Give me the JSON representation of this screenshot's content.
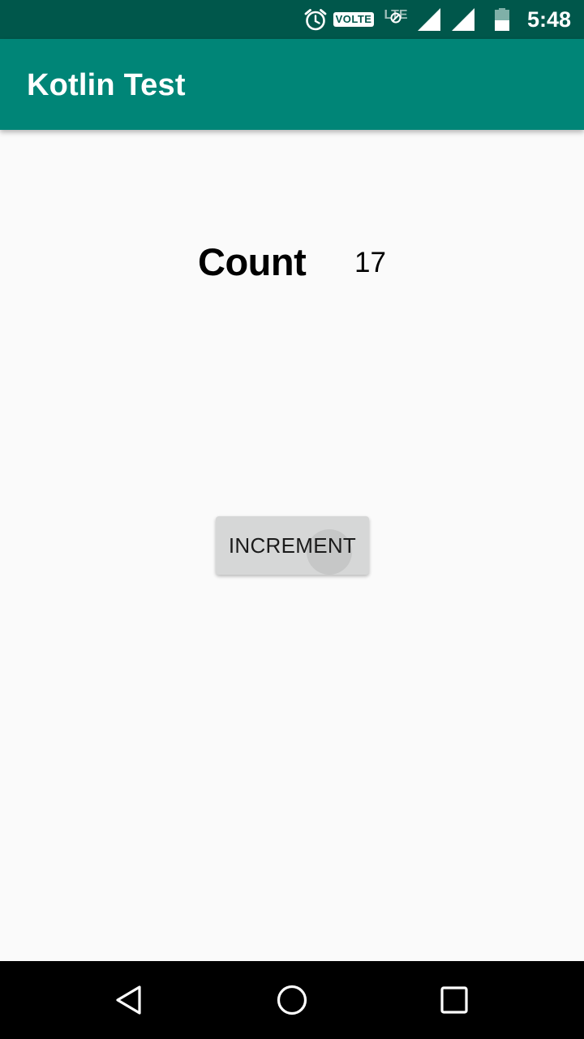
{
  "status_bar": {
    "time": "5:48",
    "volte_label": "VOLTE",
    "network_label": "LTE",
    "icons": [
      "alarm-icon",
      "volte-icon",
      "lte-icon",
      "signal-icon",
      "signal-icon",
      "battery-icon"
    ]
  },
  "app_bar": {
    "title": "Kotlin Test",
    "color": "#008577"
  },
  "main": {
    "count_label": "Count",
    "count_value": "17",
    "increment_label": "INCREMENT"
  },
  "nav_bar": {
    "buttons": [
      "back-icon",
      "home-icon",
      "recents-icon"
    ]
  }
}
